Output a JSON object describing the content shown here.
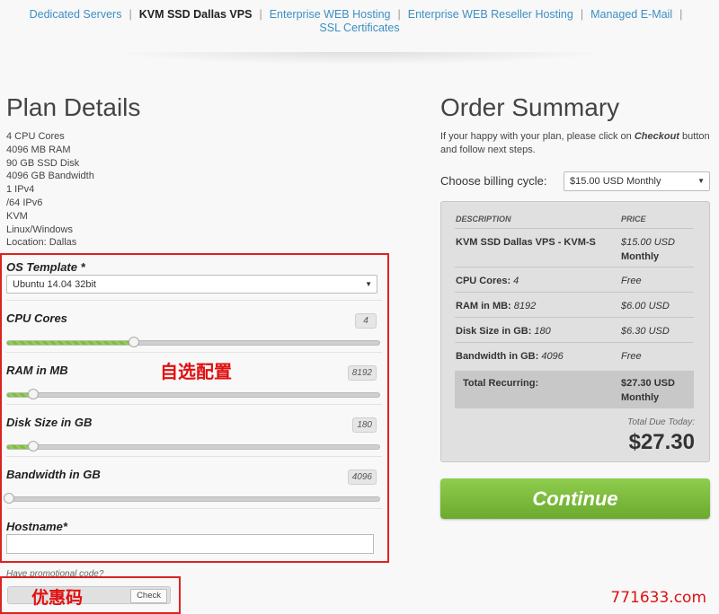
{
  "nav": {
    "items": [
      {
        "label": "Dedicated Servers",
        "active": false
      },
      {
        "label": "KVM SSD Dallas VPS",
        "active": true
      },
      {
        "label": "Enterprise WEB Hosting",
        "active": false
      },
      {
        "label": "Enterprise WEB Reseller Hosting",
        "active": false
      },
      {
        "label": "Managed E-Mail",
        "active": false
      }
    ],
    "second_row": "SSL Certificates",
    "separator": "|"
  },
  "plan": {
    "title": "Plan Details",
    "specs": [
      "4 CPU Cores",
      "4096 MB RAM",
      "90 GB SSD Disk",
      "4096 GB Bandwidth",
      "1 IPv4",
      "/64 IPv6",
      "KVM",
      "Linux/Windows",
      "Location: Dallas"
    ]
  },
  "config": {
    "os_label": "OS Template *",
    "os_value": "Ubuntu 14.04 32bit",
    "sliders": [
      {
        "label": "CPU Cores",
        "value": "4",
        "fill_fraction": 0.34
      },
      {
        "label": "RAM in MB",
        "value": "8192",
        "fill_fraction": 0.07
      },
      {
        "label": "Disk Size in GB",
        "value": "180",
        "fill_fraction": 0.07
      },
      {
        "label": "Bandwidth in GB",
        "value": "4096",
        "fill_fraction": 0.0
      }
    ],
    "hostname_label": "Hostname*",
    "hostname_value": "",
    "annotation": "自选配置"
  },
  "promo": {
    "label": "Have promotional code?",
    "button": "Check",
    "annotation": "优惠码"
  },
  "order": {
    "title": "Order Summary",
    "note_pre": "If your happy with your plan, please click on ",
    "note_bold": "Checkout",
    "note_post": " button and follow next steps.",
    "billing_label": "Choose billing cycle:",
    "billing_value": "$15.00 USD Monthly",
    "headers": {
      "description": "DESCRIPTION",
      "price": "PRICE"
    },
    "rows": [
      {
        "desc_bold": "KVM SSD Dallas VPS - KVM-S",
        "desc_rest": "",
        "price": "$15.00 USD",
        "price_bold": "Monthly"
      },
      {
        "desc_bold": "CPU Cores:",
        "desc_rest": " 4",
        "price": "Free",
        "price_bold": ""
      },
      {
        "desc_bold": "RAM in MB:",
        "desc_rest": " 8192",
        "price": "$6.00 USD",
        "price_bold": ""
      },
      {
        "desc_bold": "Disk Size in GB:",
        "desc_rest": " 180",
        "price": "$6.30 USD",
        "price_bold": ""
      },
      {
        "desc_bold": "Bandwidth in GB:",
        "desc_rest": " 4096",
        "price": "Free",
        "price_bold": ""
      }
    ],
    "recurring_label": "Total Recurring:",
    "recurring_price": "$27.30 USD",
    "recurring_period": "Monthly",
    "due_label": "Total Due Today:",
    "due_total": "$27.30",
    "continue_label": "Continue"
  },
  "watermark": "771633.com",
  "colors": {
    "accent_green": "#7bbf3a",
    "link_blue": "#3d8fc4",
    "annotation_red": "#e01010"
  }
}
